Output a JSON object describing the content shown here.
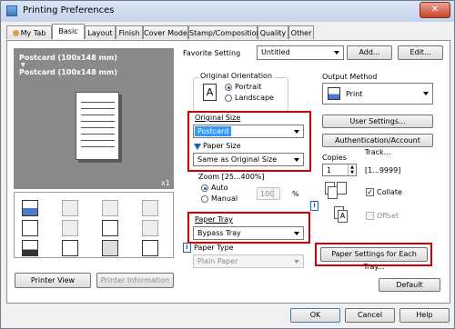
{
  "window": {
    "title": "Printing Preferences",
    "close_label": "✕"
  },
  "tabs": [
    {
      "label": "My Tab",
      "active": false
    },
    {
      "label": "Basic",
      "active": true
    },
    {
      "label": "Layout",
      "active": false
    },
    {
      "label": "Finish",
      "active": false
    },
    {
      "label": "Cover Mode",
      "active": false
    },
    {
      "label": "Stamp/Composition",
      "active": false
    },
    {
      "label": "Quality",
      "active": false
    },
    {
      "label": "Other",
      "active": false
    }
  ],
  "preview": {
    "line1": "Postcard (100x148 mm)",
    "line2": "▼",
    "line3": "Postcard (100x148 mm)",
    "copies_badge": "x1"
  },
  "buttons": {
    "printer_view": "Printer View",
    "printer_information": "Printer Information",
    "add": "Add...",
    "edit": "Edit...",
    "user_settings": "User Settings...",
    "auth_account_track": "Authentication/Account Track...",
    "paper_settings_each_tray": "Paper Settings for Each Tray...",
    "default": "Default",
    "ok": "OK",
    "cancel": "Cancel",
    "apply": "Apply",
    "help": "Help"
  },
  "favorite_setting": {
    "label": "Favorite Setting",
    "value": "Untitled"
  },
  "original_orientation": {
    "label": "Original Orientation",
    "options": [
      {
        "label": "Portrait",
        "selected": true
      },
      {
        "label": "Landscape",
        "selected": false
      }
    ]
  },
  "original_size": {
    "label": "Original Size",
    "value": "Postcard"
  },
  "paper_size": {
    "label": "Paper Size",
    "value": "Same as Original Size"
  },
  "zoom": {
    "label": "Zoom [25...400%]",
    "options": [
      {
        "label": "Auto",
        "selected": true
      },
      {
        "label": "Manual",
        "selected": false
      }
    ],
    "value": "100",
    "unit": "%"
  },
  "paper_tray": {
    "label": "Paper Tray",
    "value": "Bypass Tray"
  },
  "paper_type": {
    "label": "Paper Type",
    "value": "Plain Paper"
  },
  "output_method": {
    "label": "Output Method",
    "value": "Print"
  },
  "copies": {
    "label": "Copies",
    "value": "1",
    "range": "[1...9999]"
  },
  "collate": {
    "label": "Collate",
    "checked": true
  },
  "offset": {
    "label": "Offset",
    "checked": false
  },
  "info_glyph": "i",
  "colors": {
    "highlight_red": "#d40000",
    "selection_blue": "#3399ff"
  }
}
